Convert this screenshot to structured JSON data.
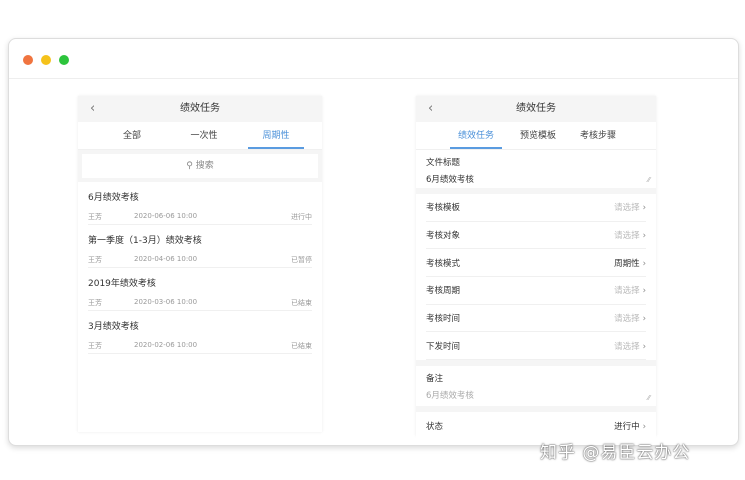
{
  "window": {
    "dots": [
      "#f0743f",
      "#f5c21b",
      "#2dc43c"
    ]
  },
  "left": {
    "title": "绩效任务",
    "tabs": [
      {
        "label": "全部"
      },
      {
        "label": "一次性"
      },
      {
        "label": "周期性"
      }
    ],
    "search_placeholder": "搜索",
    "items": [
      {
        "title": "6月绩效考核",
        "owner": "王芳",
        "date": "2020-06-06  10:00",
        "status": "进行中"
      },
      {
        "title": "第一季度（1-3月）绩效考核",
        "owner": "王芳",
        "date": "2020-04-06  10:00",
        "status": "已暂停"
      },
      {
        "title": "2019年绩效考核",
        "owner": "王芳",
        "date": "2020-03-06  10:00",
        "status": "已结束"
      },
      {
        "title": "3月绩效考核",
        "owner": "王芳",
        "date": "2020-02-06  10:00",
        "status": "已结束"
      }
    ]
  },
  "right": {
    "title": "绩效任务",
    "tabs": [
      {
        "label": "绩效任务"
      },
      {
        "label": "预览模板"
      },
      {
        "label": "考核步骤"
      }
    ],
    "file_title": {
      "label": "文件标题",
      "value": "6月绩效考核"
    },
    "rows": [
      {
        "label": "考核模板",
        "value": "请选择"
      },
      {
        "label": "考核对象",
        "value": "请选择"
      },
      {
        "label": "考核模式",
        "value": "周期性"
      },
      {
        "label": "考核周期",
        "value": "请选择"
      },
      {
        "label": "考核时间",
        "value": "请选择"
      },
      {
        "label": "下发时间",
        "value": "请选择"
      }
    ],
    "notes": {
      "label": "备注",
      "placeholder": "6月绩效考核"
    },
    "status": {
      "label": "状态",
      "value": "进行中"
    }
  },
  "watermark": "知乎 @易臣云办公"
}
